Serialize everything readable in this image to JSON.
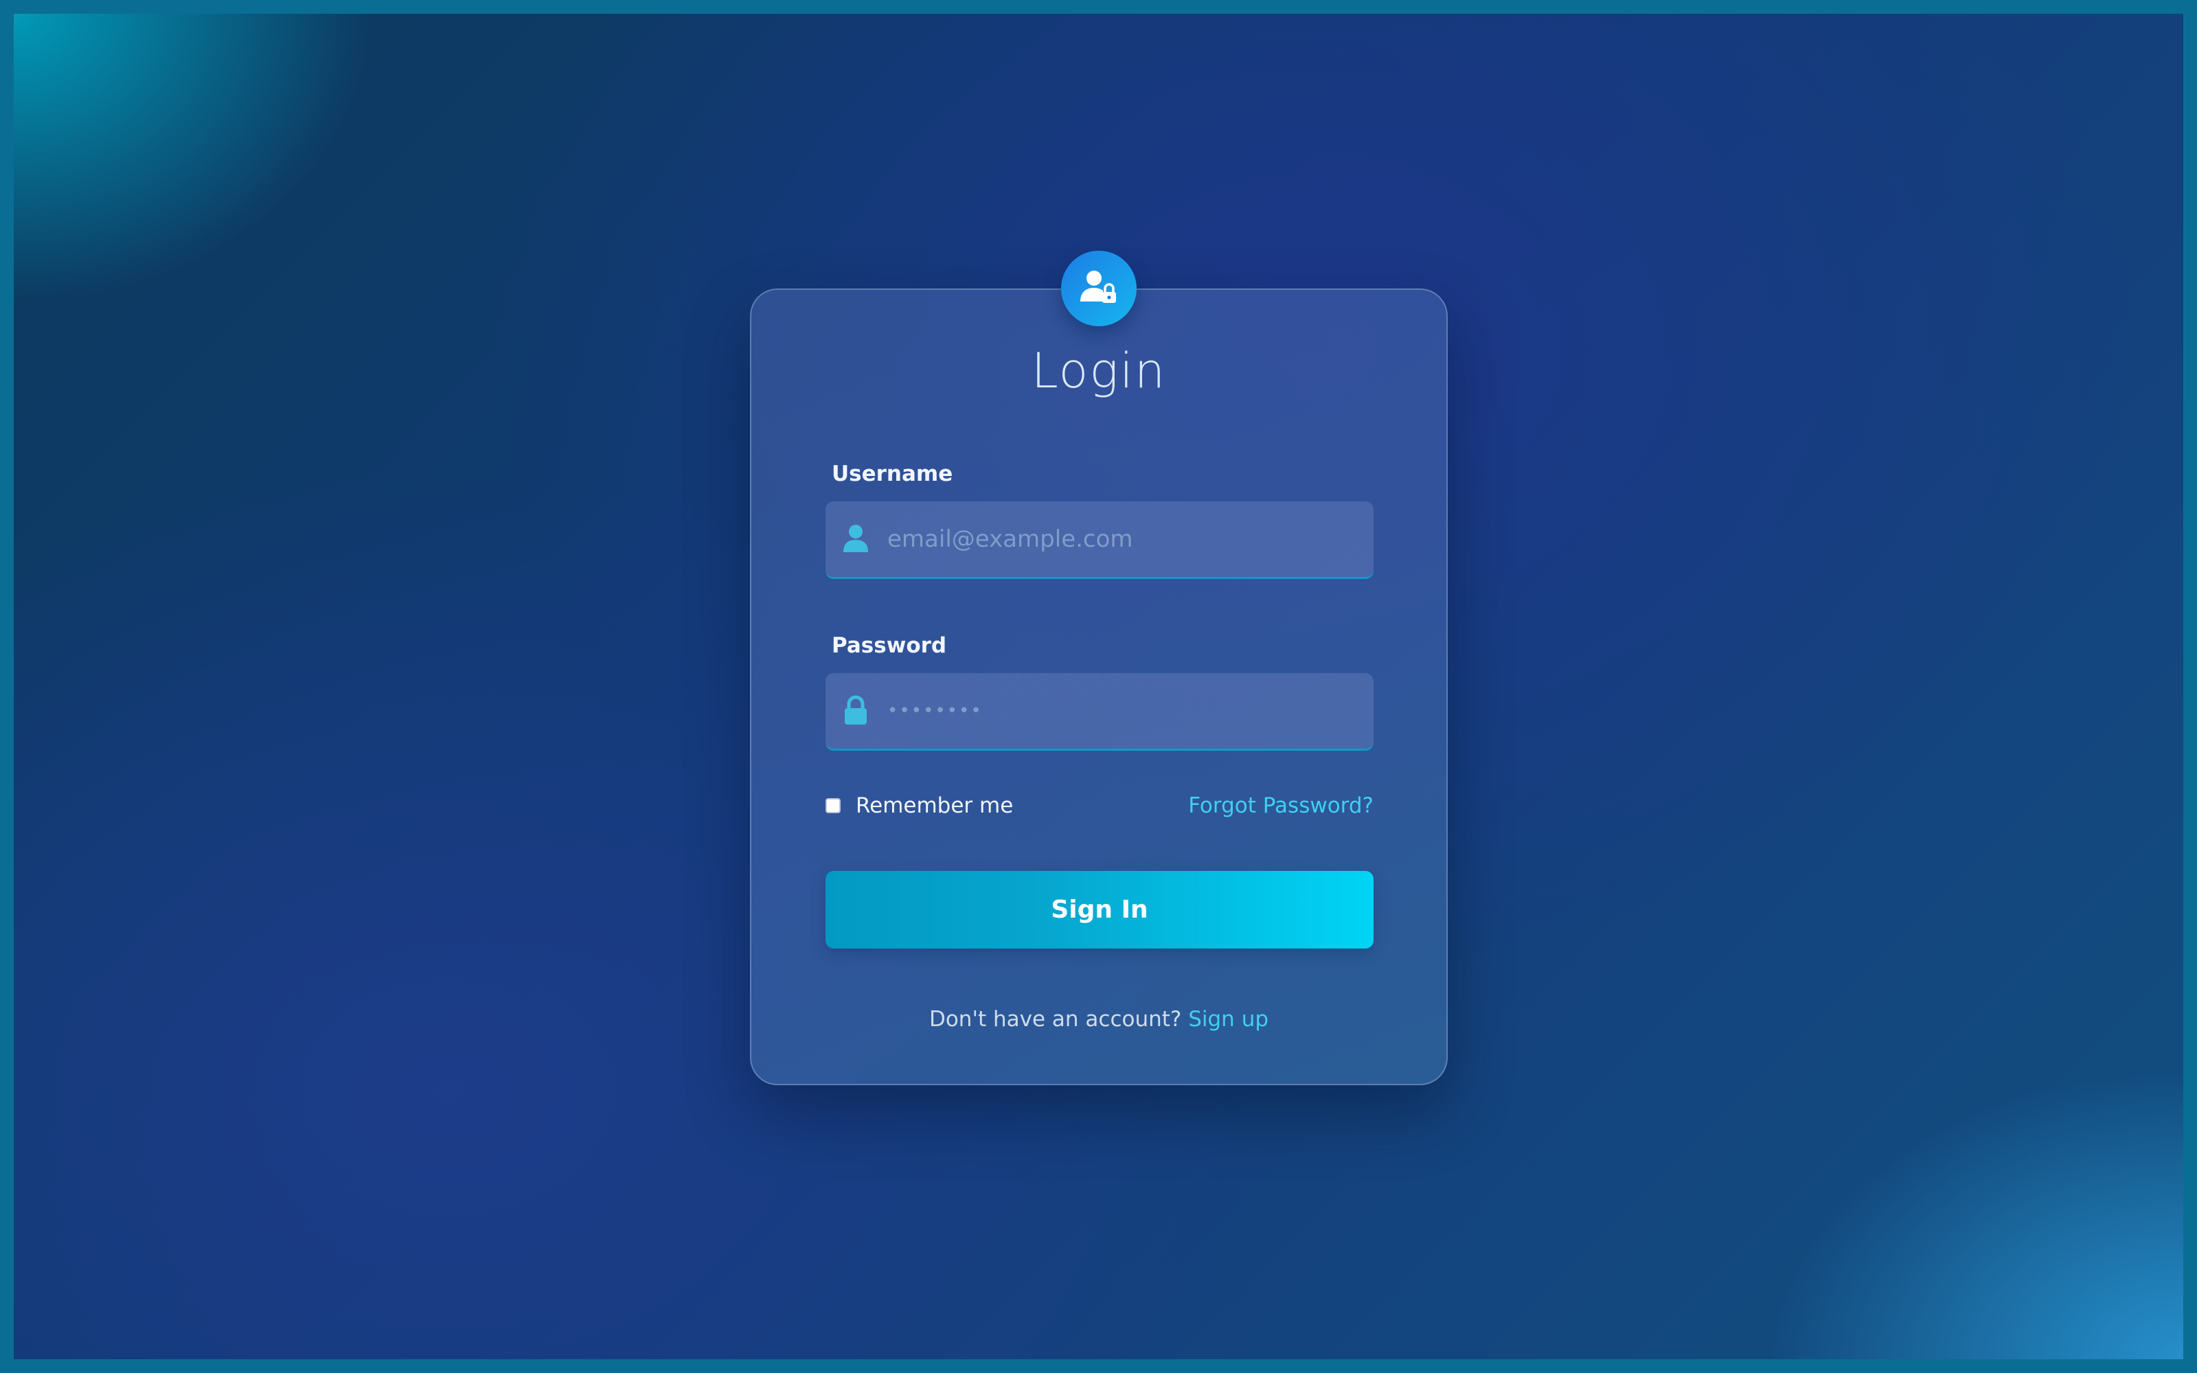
{
  "header": {
    "title": "Login",
    "badge_icon": "user-lock-icon"
  },
  "form": {
    "username_label": "Username",
    "username_placeholder": "email@example.com",
    "username_icon": "user-icon",
    "password_label": "Password",
    "password_placeholder": "••••••••",
    "password_icon": "lock-icon",
    "remember_label": "Remember me",
    "remember_checked": false,
    "forgot_label": "Forgot Password?",
    "submit_label": "Sign In"
  },
  "footer": {
    "prompt": "Don't have an account?",
    "signup_label": "Sign up"
  },
  "colors": {
    "accent": "#3fd0f0",
    "button_start": "#0399c2",
    "button_end": "#00d4f5",
    "badge": "#1c7de6"
  }
}
